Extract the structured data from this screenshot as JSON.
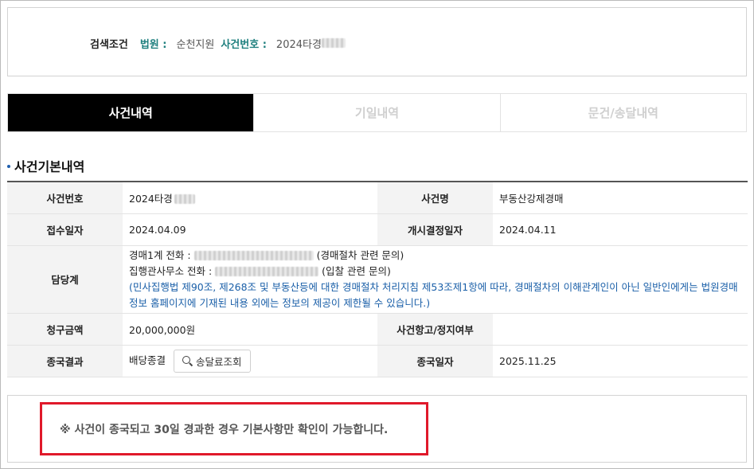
{
  "search": {
    "title": "검색조건",
    "court_label": "법원 :",
    "court_value": "순천지원",
    "case_no_label": "사건번호 :",
    "case_no_value": "2024타경"
  },
  "tabs": [
    {
      "label": "사건내역",
      "active": true
    },
    {
      "label": "기일내역",
      "active": false
    },
    {
      "label": "문건/송달내역",
      "active": false
    }
  ],
  "section": {
    "title": "사건기본내역"
  },
  "table": {
    "case_no_label": "사건번호",
    "case_no_value": "2024타경",
    "case_name_label": "사건명",
    "case_name_value": "부동산강제경매",
    "receipt_date_label": "접수일자",
    "receipt_date_value": "2024.04.09",
    "start_decision_label": "개시결정일자",
    "start_decision_value": "2024.04.11",
    "manager_label": "담당계",
    "manager_line1_prefix": "경매1계  전화 :",
    "manager_line1_suffix": "(경매절차 관련 문의)",
    "manager_line2_prefix": "집행관사무소   전화 :",
    "manager_line2_suffix": "(입찰 관련 문의)",
    "manager_notice": "(민사집행법 제90조, 제268조 및 부동산등에 대한 경매절차 처리지침 제53조제1항에 따라, 경매절차의 이해관계인이 아닌 일반인에게는 법원경매정보 홈페이지에 기재된 내용 외에는 정보의 제공이 제한될 수 있습니다.)",
    "claim_amount_label": "청구금액",
    "claim_amount_value": "20,000,000원",
    "appeal_label": "사건항고/정지여부",
    "appeal_value": "",
    "final_result_label": "종국결과",
    "final_result_value": "배당종결",
    "fee_button_label": "송달료조회",
    "final_date_label": "종국일자",
    "final_date_value": "2025.11.25"
  },
  "notice": {
    "text": "※ 사건이 종국되고 30일 경과한 경우 기본사항만 확인이 가능합니다."
  },
  "colors": {
    "accent_teal": "#1e7f7e",
    "notice_blue": "#1a5fa8",
    "highlight_red": "#e0192a",
    "tab_active_bg": "#000000"
  }
}
